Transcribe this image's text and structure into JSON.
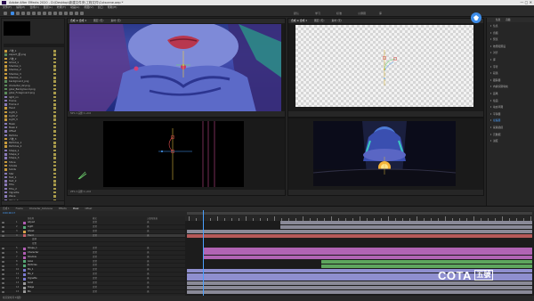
{
  "window": {
    "title": "Adobe After Effects 2020 - D:\\Desktop\\新建文件夹\\工程文件\\Cutscene.aep *"
  },
  "menu": [
    "文件(F)",
    "编辑(E)",
    "合成(C)",
    "图层(L)",
    "效果(T)",
    "动画(A)",
    "视图(V)",
    "窗口",
    "帮助(H)"
  ],
  "workspace": [
    "默认",
    "学习",
    "标准",
    "小屏幕",
    "库"
  ],
  "project": {
    "panel_label": "项目",
    "search_placeholder": "",
    "items": [
      {
        "name": "人物_1",
        "type": "folder"
      },
      {
        "name": "Aspect_组.png",
        "type": "img"
      },
      {
        "name": "人物_2",
        "type": "folder"
      },
      {
        "name": "Ghost_1",
        "type": "folder"
      },
      {
        "name": "Shadow_1",
        "type": "folder"
      },
      {
        "name": "Shadow_2",
        "type": "folder"
      },
      {
        "name": "Shadow_3",
        "type": "folder"
      },
      {
        "name": "Shadow_4",
        "type": "folder"
      },
      {
        "name": "background_png",
        "type": "img"
      },
      {
        "name": "character_02.png",
        "type": "img"
      },
      {
        "name": "glow_Background.png",
        "type": "img"
      },
      {
        "name": "glow_Foreground.png",
        "type": "img"
      },
      {
        "name": "light_on",
        "type": "comp"
      },
      {
        "name": "Frame",
        "type": "comp"
      },
      {
        "name": "Frame 2",
        "type": "comp"
      },
      {
        "name": "Hand",
        "type": "folder"
      },
      {
        "name": "Light_1",
        "type": "folder"
      },
      {
        "name": "Light_2",
        "type": "folder"
      },
      {
        "name": "Light_3",
        "type": "folder"
      },
      {
        "name": "Mask",
        "type": "comp"
      },
      {
        "name": "Mask 2",
        "type": "comp"
      },
      {
        "name": "Offset",
        "type": "comp"
      },
      {
        "name": "Particle",
        "type": "comp"
      },
      {
        "name": "人物_3",
        "type": "folder"
      },
      {
        "name": "Particles_1",
        "type": "folder"
      },
      {
        "name": "Particles_2",
        "type": "folder"
      },
      {
        "name": "Shape_1",
        "type": "comp"
      },
      {
        "name": "Shape_2",
        "type": "comp"
      },
      {
        "name": "Shape_3",
        "type": "comp"
      },
      {
        "name": "Shine",
        "type": "folder"
      },
      {
        "name": "Smoke",
        "type": "folder"
      },
      {
        "name": "Solids",
        "type": "folder"
      },
      {
        "name": "Star",
        "type": "comp"
      },
      {
        "name": "Text_1",
        "type": "comp"
      },
      {
        "name": "Text_2",
        "type": "comp"
      },
      {
        "name": "Title",
        "type": "comp"
      },
      {
        "name": "Title_2",
        "type": "comp"
      },
      {
        "name": "Vignette",
        "type": "comp"
      },
      {
        "name": "Wave",
        "type": "comp"
      },
      {
        "name": "Wave_2",
        "type": "comp"
      },
      {
        "name": "Zoom",
        "type": "comp"
      }
    ]
  },
  "viewer_top_left": {
    "tabs": [
      "合成 ≡ 合成 1",
      "图层 (无)",
      "素材 (无)"
    ],
    "footer": "50%   ▾   完整   ▾   +0.0"
  },
  "viewer_top_right": {
    "tabs": [
      "合成 ≡ 合成 1",
      "图层 (无)",
      "素材 (无)"
    ],
    "footer": ""
  },
  "viewer_bottom_left": {
    "footer": "25%   ▾   完整   ▾   +0.0"
  },
  "viewer_bottom_right": {
    "footer": ""
  },
  "right_panel": {
    "tabs": [
      "信息",
      "音频"
    ],
    "items": [
      {
        "label": "信息",
        "highlight": false
      },
      {
        "label": "音频",
        "highlight": false
      },
      {
        "label": "预览",
        "highlight": false
      },
      {
        "label": "效果和预设",
        "highlight": false
      },
      {
        "label": "对齐",
        "highlight": false
      },
      {
        "label": "库",
        "highlight": false
      },
      {
        "label": "字符",
        "highlight": false
      },
      {
        "label": "段落",
        "highlight": false
      },
      {
        "label": "跟踪器",
        "highlight": false
      },
      {
        "label": "内容识别填充",
        "highlight": false
      },
      {
        "label": "画笔",
        "highlight": false
      },
      {
        "label": "绘画",
        "highlight": false
      },
      {
        "label": "动态草图",
        "highlight": false
      },
      {
        "label": "平滑器",
        "highlight": false
      },
      {
        "label": "摇摆器",
        "highlight": true
      },
      {
        "label": "蒙版插值",
        "highlight": false
      },
      {
        "label": "元数据",
        "highlight": false
      },
      {
        "label": "进度",
        "highlight": false
      }
    ]
  },
  "timeline": {
    "tabs": [
      {
        "label": "合成 1",
        "active": false
      },
      {
        "label": "Frame",
        "active": false
      },
      {
        "label": "Character_Cutscene",
        "active": false
      },
      {
        "label": "Effects",
        "active": false
      },
      {
        "label": "Mask",
        "active": true
      },
      {
        "label": "Offset",
        "active": false
      }
    ],
    "timecode": "0:00:00:17",
    "col_source": "源名称",
    "col_mode": "模式",
    "col_parent": "父级和链接",
    "layers": [
      {
        "num": "1",
        "name": "Adjust",
        "color": "#b05db2",
        "mode": "正常",
        "parent": "无",
        "sel": false,
        "sub": false
      },
      {
        "num": "2",
        "name": "Light",
        "color": "#55a876",
        "mode": "正常",
        "parent": "无",
        "sel": false,
        "sub": false
      },
      {
        "num": "3",
        "name": "Ghost",
        "color": "#d6a24a",
        "mode": "正常",
        "parent": "无",
        "sel": false,
        "sub": false
      },
      {
        "num": "4",
        "name": "Hand",
        "color": "#c45f6a",
        "mode": "正常",
        "parent": "无",
        "sel": true,
        "sub": false
      },
      {
        "num": "",
        "name": "变换",
        "color": "",
        "mode": "",
        "parent": "",
        "sel": false,
        "sub": true
      },
      {
        "num": "",
        "name": "位置",
        "color": "",
        "mode": "",
        "parent": "",
        "sel": false,
        "sub": true
      },
      {
        "num": "5",
        "name": "Shape_1",
        "color": "#b05db2",
        "mode": "正常",
        "parent": "无",
        "sel": false,
        "sub": false
      },
      {
        "num": "6",
        "name": "Character",
        "color": "#b05db2",
        "mode": "正常",
        "parent": "无",
        "sel": false,
        "sub": false
      },
      {
        "num": "7",
        "name": "Shadow",
        "color": "#b05db2",
        "mode": "正常",
        "parent": "无",
        "sel": false,
        "sub": false
      },
      {
        "num": "8",
        "name": "Glow",
        "color": "#55a876",
        "mode": "正常",
        "parent": "无",
        "sel": false,
        "sub": false
      },
      {
        "num": "9",
        "name": "Particles",
        "color": "#55a876",
        "mode": "正常",
        "parent": "无",
        "sel": false,
        "sub": false
      },
      {
        "num": "10",
        "name": "BG_1",
        "color": "#7a7ad0",
        "mode": "正常",
        "parent": "无",
        "sel": false,
        "sub": false
      },
      {
        "num": "11",
        "name": "BG_2",
        "color": "#7a7ad0",
        "mode": "正常",
        "parent": "无",
        "sel": false,
        "sub": false
      },
      {
        "num": "12",
        "name": "Vignette",
        "color": "#7a7ad0",
        "mode": "正常",
        "parent": "无",
        "sel": false,
        "sub": false
      },
      {
        "num": "13",
        "name": "Solid",
        "color": "#9a9a9a",
        "mode": "正常",
        "parent": "无",
        "sel": false,
        "sub": false
      },
      {
        "num": "14",
        "name": "Stage",
        "color": "#9a9a9a",
        "mode": "正常",
        "parent": "无",
        "sel": false,
        "sub": false
      },
      {
        "num": "15",
        "name": "BG",
        "color": "#9a9a9a",
        "mode": "正常",
        "parent": "无",
        "sel": false,
        "sub": false
      }
    ],
    "tracks": [
      {
        "start": 0.27,
        "end": 1.0,
        "color": "#8a8a98"
      },
      {
        "start": 0.27,
        "end": 1.0,
        "color": "#8a8a98"
      },
      {
        "start": 0.0,
        "end": 1.0,
        "color": "#8a8a98"
      },
      {
        "start": 0.0,
        "end": 1.0,
        "color": "#b55a5a"
      },
      null,
      null,
      {
        "start": 0.05,
        "end": 1.0,
        "color": "#b164b4"
      },
      {
        "start": 0.05,
        "end": 1.0,
        "color": "#b164b4"
      },
      {
        "start": 0.05,
        "end": 1.0,
        "color": "#b164b4"
      },
      {
        "start": 0.39,
        "end": 1.0,
        "color": "#5ea65e"
      },
      {
        "start": 0.39,
        "end": 1.0,
        "color": "#5ea65e"
      },
      {
        "start": 0.0,
        "end": 1.0,
        "color": "#8f8fcf"
      },
      {
        "start": 0.0,
        "end": 1.0,
        "color": "#8f8fcf"
      },
      {
        "start": 0.0,
        "end": 1.0,
        "color": "#8f8fcf"
      },
      {
        "start": 0.0,
        "end": 1.0,
        "color": "#8a8a98"
      },
      {
        "start": 0.0,
        "end": 1.0,
        "color": "#8a8a98"
      },
      {
        "start": 0.0,
        "end": 1.0,
        "color": "#8a8a98"
      }
    ],
    "footer": "帧渲染时间  0毫秒"
  },
  "watermark": {
    "brand": "COTA",
    "mark": "五號"
  },
  "colors": {
    "accent": "#3d8ce8",
    "playhead": "#4aa1ff"
  }
}
